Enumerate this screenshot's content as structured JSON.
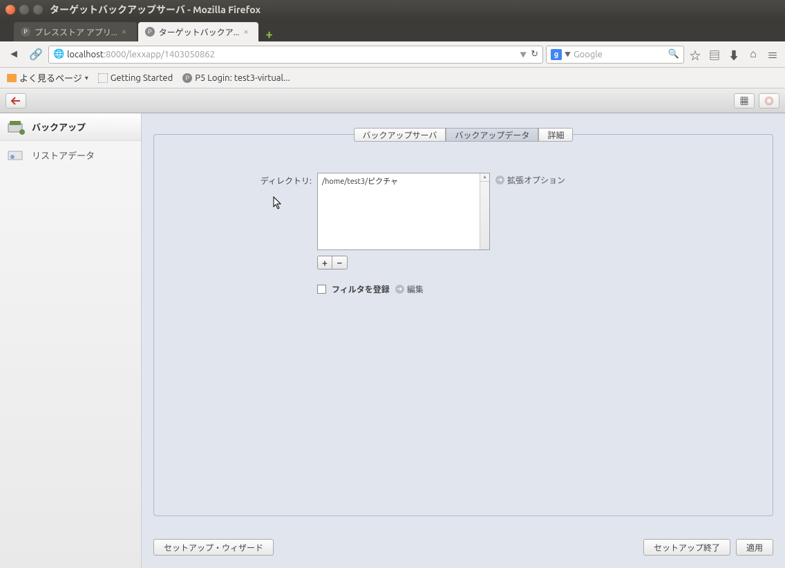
{
  "window": {
    "title": "ターゲットバックアップサーバ - Mozilla Firefox"
  },
  "tabs": [
    {
      "label": "プレスストア アプリ...",
      "active": false
    },
    {
      "label": "ターゲットバックア...",
      "active": true
    }
  ],
  "url": {
    "host": "localhost",
    "port_path": ":8000/lexxapp/1403050862"
  },
  "search": {
    "placeholder": "Google"
  },
  "bookmarks": {
    "most_visited": "よく見るページ",
    "getting_started": "Getting Started",
    "p5_login": "P5 Login: test3-virtual..."
  },
  "sidebar": {
    "items": [
      {
        "label": "バックアップ",
        "active": true
      },
      {
        "label": "リストアデータ",
        "active": false
      }
    ]
  },
  "panel_tabs": [
    {
      "label": "バックアップサーバ",
      "active": false
    },
    {
      "label": "バックアップデータ",
      "active": true
    },
    {
      "label": "詳細",
      "active": false
    }
  ],
  "form": {
    "directory_label": "ディレクトリ:",
    "directory_value": "/home/test3/ピクチャ",
    "ext_options": "拡張オプション",
    "filter_label": "フィルタを登録",
    "edit_label": "編集"
  },
  "buttons": {
    "setup_wizard": "セットアップ・ウィザード",
    "setup_end": "セットアップ終了",
    "apply": "適用"
  }
}
